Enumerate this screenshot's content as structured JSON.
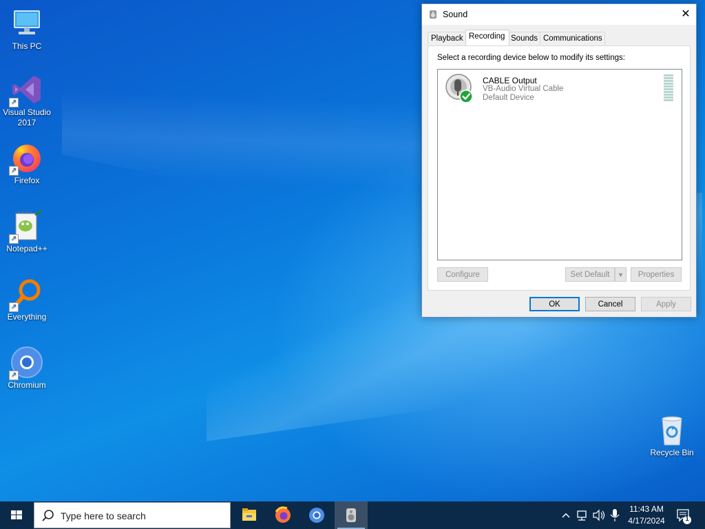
{
  "desktop": {
    "icons": [
      {
        "label": "This PC"
      },
      {
        "label": "Visual Studio 2017"
      },
      {
        "label": "Firefox"
      },
      {
        "label": "Notepad++"
      },
      {
        "label": "Everything"
      },
      {
        "label": "Chromium"
      }
    ],
    "recycle_bin": "Recycle Bin"
  },
  "dialog": {
    "title": "Sound",
    "close_glyph": "✕",
    "tabs": [
      "Playback",
      "Recording",
      "Sounds",
      "Communications"
    ],
    "active_tab": "Recording",
    "instruction": "Select a recording device below to modify its settings:",
    "device": {
      "name": "CABLE Output",
      "description": "VB-Audio Virtual Cable",
      "status": "Default Device",
      "icon": "microphone-device-icon"
    },
    "buttons": {
      "configure": "Configure",
      "set_default": "Set Default",
      "properties": "Properties",
      "ok": "OK",
      "cancel": "Cancel",
      "apply": "Apply"
    }
  },
  "taskbar": {
    "search_placeholder": "Type here to search",
    "apps": [
      "file-explorer-icon",
      "firefox-icon",
      "chromium-icon",
      "sound-settings-icon"
    ],
    "active_app": "sound-settings-icon",
    "time": "11:43 AM",
    "date": "4/17/2024",
    "notification_count": "1"
  },
  "colors": {
    "accent": "#0078d7",
    "taskbar": "#0b2a4a",
    "desktop": "#0a77dc"
  }
}
